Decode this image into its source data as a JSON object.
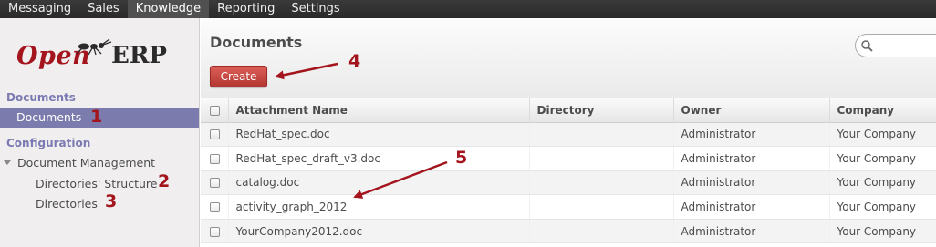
{
  "topbar": {
    "items": [
      {
        "label": "Messaging"
      },
      {
        "label": "Sales"
      },
      {
        "label": "Knowledge",
        "active": true
      },
      {
        "label": "Reporting"
      },
      {
        "label": "Settings"
      }
    ]
  },
  "logo": {
    "part1": "Open",
    "part2": "ERP"
  },
  "sidebar": {
    "section1": "Documents",
    "item_documents": "Documents",
    "section2": "Configuration",
    "item_document_management": "Document Management",
    "item_directories_structure": "Directories' Structure",
    "item_directories": "Directories"
  },
  "header": {
    "title": "Documents",
    "create_label": "Create",
    "search_placeholder": ""
  },
  "table": {
    "columns": [
      "Attachment Name",
      "Directory",
      "Owner",
      "Company"
    ],
    "rows": [
      {
        "name": "RedHat_spec.doc",
        "directory": "",
        "owner": "Administrator",
        "company": "Your Company"
      },
      {
        "name": "RedHat_spec_draft_v3.doc",
        "directory": "",
        "owner": "Administrator",
        "company": "Your Company"
      },
      {
        "name": "catalog.doc",
        "directory": "",
        "owner": "Administrator",
        "company": "Your Company"
      },
      {
        "name": "activity_graph_2012",
        "directory": "",
        "owner": "Administrator",
        "company": "Your Company"
      },
      {
        "name": "YourCompany2012.doc",
        "directory": "",
        "owner": "Administrator",
        "company": "Your Company"
      }
    ]
  },
  "callouts": {
    "c1": "1",
    "c2": "2",
    "c3": "3",
    "c4": "4",
    "c5": "5"
  },
  "colors": {
    "accent": "#a3141c",
    "selection": "#7c7bad",
    "section": "#7b7bb3"
  }
}
